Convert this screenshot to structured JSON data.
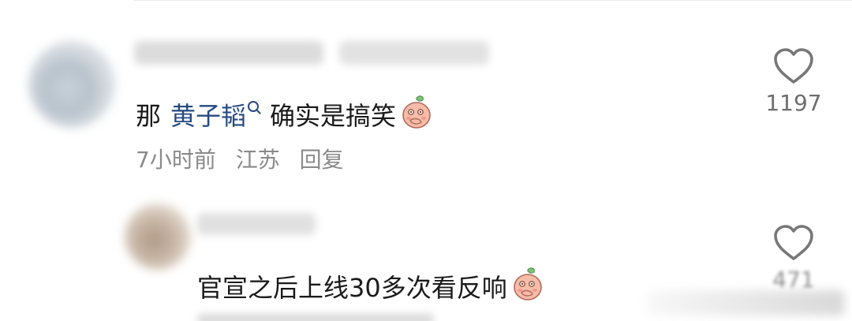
{
  "comments": [
    {
      "text_before": "那",
      "mention": "黄子韬",
      "text_after": "确实是搞笑",
      "emoji": "peach-emoji",
      "time": "7小时前",
      "location": "江苏",
      "reply_label": "回复",
      "like_count": "1197"
    },
    {
      "text": "官宣之后上线30多次看反响",
      "emoji": "peach-emoji",
      "like_count": "471"
    }
  ],
  "icons": {
    "like": "heart-outline-icon",
    "mention_search": "search-icon"
  },
  "colors": {
    "mention": "#254a80",
    "meta_text": "#8a8a8a",
    "body_text": "#1b1b1b",
    "emoji_fill": "#f4b3a0"
  }
}
